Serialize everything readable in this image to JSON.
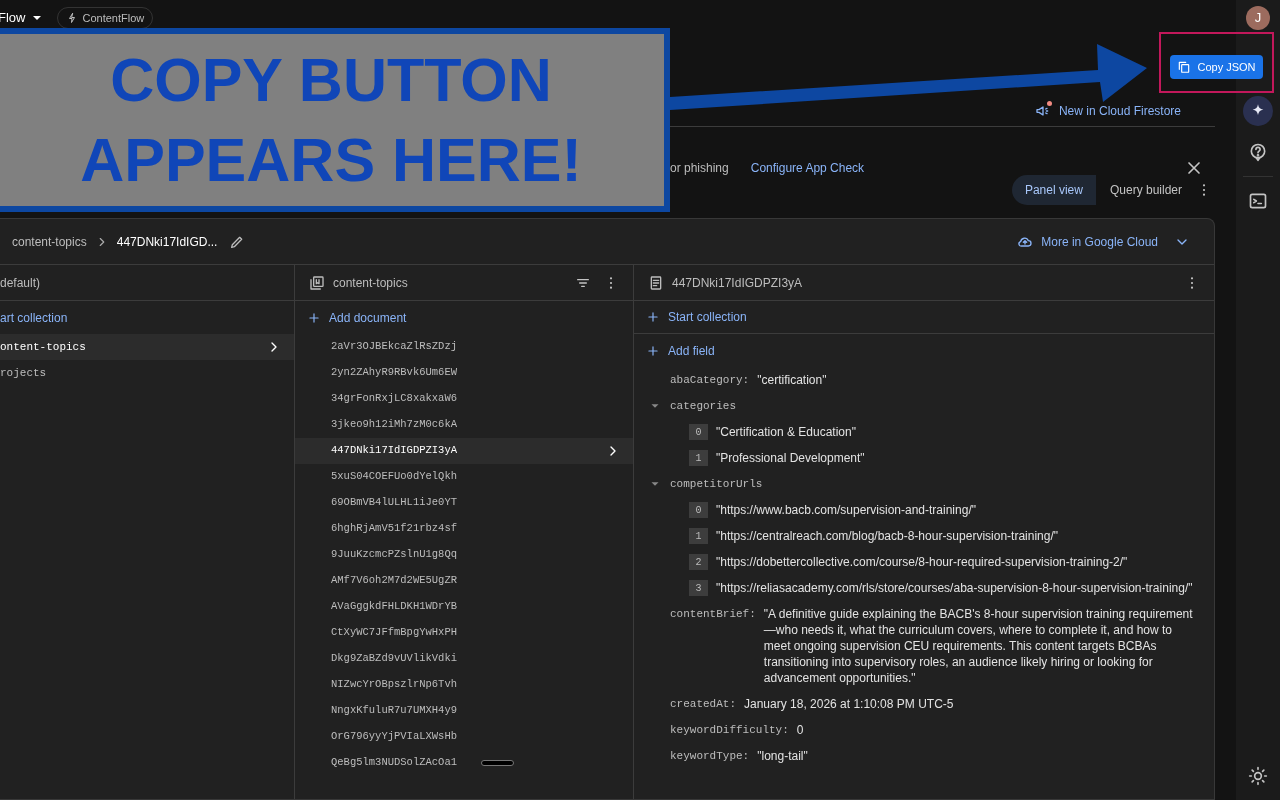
{
  "top_bar": {
    "project_menu": "Flow",
    "project_chip": "ContentFlow"
  },
  "callout": {
    "lines": [
      "COPY BUTTON",
      "APPEARS HERE!"
    ]
  },
  "copy_button": {
    "label": "Copy JSON"
  },
  "whats_new": "New in Cloud Firestore",
  "banner": {
    "text": "or phishing",
    "link": "Configure App Check"
  },
  "view_tabs": [
    {
      "label": "Panel view",
      "selected": true
    },
    {
      "label": "Query builder",
      "selected": false
    }
  ],
  "breadcrumb": [
    "content-topics",
    "447DNki17IdIGD..."
  ],
  "cloud_link": "More in Google Cloud",
  "root_column": {
    "title": "default)",
    "action": "art collection",
    "items": [
      {
        "label": "ontent-topics",
        "selected": true
      },
      {
        "label": "rojects",
        "selected": false
      }
    ]
  },
  "collection_column": {
    "title": "content-topics",
    "action": "Add document",
    "documents": [
      {
        "id": "2aVr3OJBEkcaZlRsZDzj",
        "selected": false
      },
      {
        "id": "2yn2ZAhyR9RBvk6Um6EW",
        "selected": false
      },
      {
        "id": "34grFonRxjLC8xakxaW6",
        "selected": false
      },
      {
        "id": "3jkeo9h12iMh7zM0c6kA",
        "selected": false
      },
      {
        "id": "447DNki17IdIGDPZI3yA",
        "selected": true
      },
      {
        "id": "5xuS04COEFUo0dYelQkh",
        "selected": false
      },
      {
        "id": "69OBmVB4lULHL1iJe0YT",
        "selected": false
      },
      {
        "id": "6hghRjAmV51f21rbz4sf",
        "selected": false
      },
      {
        "id": "9JuuKzcmcPZslnU1g8Qq",
        "selected": false
      },
      {
        "id": "AMf7V6oh2M7d2WE5UgZR",
        "selected": false
      },
      {
        "id": "AVaGggkdFHLDKH1WDrYB",
        "selected": false
      },
      {
        "id": "CtXyWC7JFfmBpgYwHxPH",
        "selected": false
      },
      {
        "id": "Dkg9ZaBZd9vUVlikVdki",
        "selected": false
      },
      {
        "id": "NIZwcYrOBpszlrNp6Tvh",
        "selected": false
      },
      {
        "id": "NngxKfuluR7u7UMXH4y9",
        "selected": false
      },
      {
        "id": "OrG796yyYjPVIaLXWsHb",
        "selected": false
      },
      {
        "id": "QeBg5lm3NUDSolZAcOa1",
        "selected": false
      }
    ]
  },
  "document_column": {
    "title": "447DNki17IdIGDPZI3yA",
    "actions": [
      "Start collection",
      "Add field"
    ],
    "fields": [
      {
        "kind": "value",
        "key": "abaCategory:",
        "value": "\"certification\""
      },
      {
        "kind": "array",
        "key": "categories",
        "expanded": true,
        "items": [
          {
            "index": "0",
            "value": "\"Certification & Education\""
          },
          {
            "index": "1",
            "value": "\"Professional Development\""
          }
        ]
      },
      {
        "kind": "array",
        "key": "competitorUrls",
        "expanded": true,
        "items": [
          {
            "index": "0",
            "value": "\"https://www.bacb.com/supervision-and-training/\""
          },
          {
            "index": "1",
            "value": "\"https://centralreach.com/blog/bacb-8-hour-supervision-training/\""
          },
          {
            "index": "2",
            "value": "\"https://dobettercollective.com/course/8-hour-required-supervision-training-2/\""
          },
          {
            "index": "3",
            "value": "\"https://reliasacademy.com/rls/store/courses/aba-supervision-8-hour-supervision-training/\""
          }
        ]
      },
      {
        "kind": "value",
        "key": "contentBrief:",
        "value": "\"A definitive guide explaining the BACB's 8-hour supervision training requirement—who needs it, what the curriculum covers, where to complete it, and how to meet ongoing supervision CEU requirements. This content targets BCBAs transitioning into supervisory roles, an audience likely hiring or looking for advancement opportunities.\""
      },
      {
        "kind": "value",
        "key": "createdAt:",
        "value": "January 18, 2026 at 1:10:08 PM UTC-5"
      },
      {
        "kind": "value",
        "key": "keywordDifficulty:",
        "value": "0"
      },
      {
        "kind": "value",
        "key": "keywordType:",
        "value": "\"long-tail\""
      }
    ]
  },
  "avatar": {
    "initial": "J"
  }
}
